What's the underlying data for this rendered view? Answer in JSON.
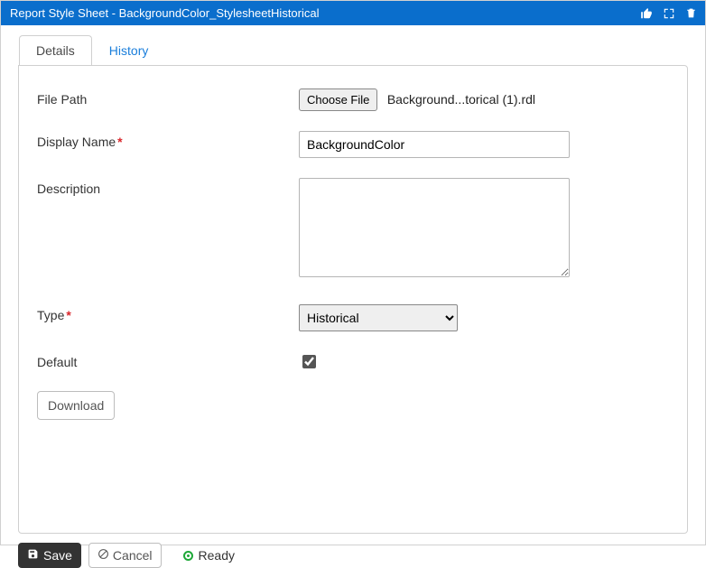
{
  "titlebar": {
    "title": "Report Style Sheet - BackgroundColor_StylesheetHistorical"
  },
  "tabs": {
    "details": "Details",
    "history": "History"
  },
  "form": {
    "filePath": {
      "label": "File Path",
      "button": "Choose File",
      "filename": "Background...torical (1).rdl"
    },
    "displayName": {
      "label": "Display Name",
      "value": "BackgroundColor"
    },
    "description": {
      "label": "Description",
      "value": ""
    },
    "type": {
      "label": "Type",
      "selected": "Historical"
    },
    "default": {
      "label": "Default",
      "checked": true
    },
    "download": "Download"
  },
  "footer": {
    "save": "Save",
    "cancel": "Cancel",
    "status": "Ready"
  }
}
